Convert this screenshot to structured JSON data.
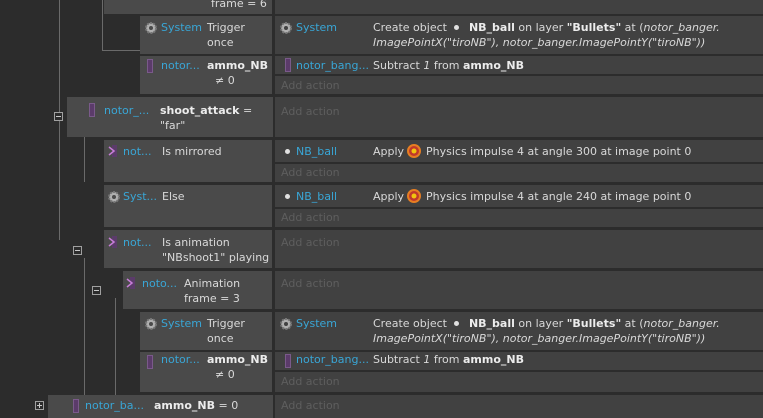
{
  "blocks": {
    "top_header": {
      "label": "frame = 6"
    },
    "trigger1": {
      "system": "System",
      "cond": "Trigger\nonce",
      "act_system": "System",
      "create_prefix": "Create object",
      "obj": "NB_ball",
      "on_layer": "on layer",
      "layer": "\"Bullets\"",
      "at": "at (",
      "arg1": "notor_banger.",
      "line2": "ImagePointX(\"tiroNB\"), notor_banger.ImagePointY(\"tiroNB\"))"
    },
    "ammo1": {
      "obj": "notor...",
      "var": "ammo_NB",
      "cmp": "≠ 0",
      "act_obj": "notor_bang...",
      "sub_prefix": "Subtract",
      "num": "1",
      "from": "from",
      "var2": "ammo_NB"
    },
    "shoot": {
      "obj": "notor_...",
      "var": "shoot_attack",
      "eq": "=",
      "val": "\"far\""
    },
    "mirrored": {
      "obj": "not...",
      "cond": "Is mirrored",
      "act_obj": "NB_ball",
      "apply": "Apply",
      "desc": "Physics impulse 4 at angle 300 at image point 0"
    },
    "else": {
      "obj": "Syst...",
      "cond": "Else",
      "act_obj": "NB_ball",
      "apply": "Apply",
      "desc": "Physics impulse 4 at angle 240 at image point 0"
    },
    "anim": {
      "obj": "not...",
      "cond1": "Is animation",
      "cond2": "\"NBshoot1\" playing"
    },
    "frame": {
      "obj": "noto...",
      "cond1": "Animation",
      "cond2": "frame = 3"
    },
    "trigger2": {
      "system": "System",
      "cond": "Trigger\nonce",
      "act_system": "System",
      "create_prefix": "Create object",
      "obj": "NB_ball",
      "on_layer": "on layer",
      "layer": "\"Bullets\"",
      "at": "at (",
      "arg1": "notor_banger.",
      "line2": "ImagePointX(\"tiroNB\"), notor_banger.ImagePointY(\"tiroNB\"))"
    },
    "ammo2": {
      "obj": "notor...",
      "var": "ammo_NB",
      "cmp": "≠ 0",
      "act_obj": "notor_bang...",
      "sub_prefix": "Subtract",
      "num": "1",
      "from": "from",
      "var2": "ammo_NB"
    },
    "bottom": {
      "obj": "notor_ba...",
      "var": "ammo_NB",
      "cmp": "= 0"
    }
  },
  "add_action": "Add action",
  "colors": {
    "object": "#39a6d6",
    "panel": "#4a4a4a",
    "action": "#414141",
    "bg": "#2c2c2c"
  }
}
